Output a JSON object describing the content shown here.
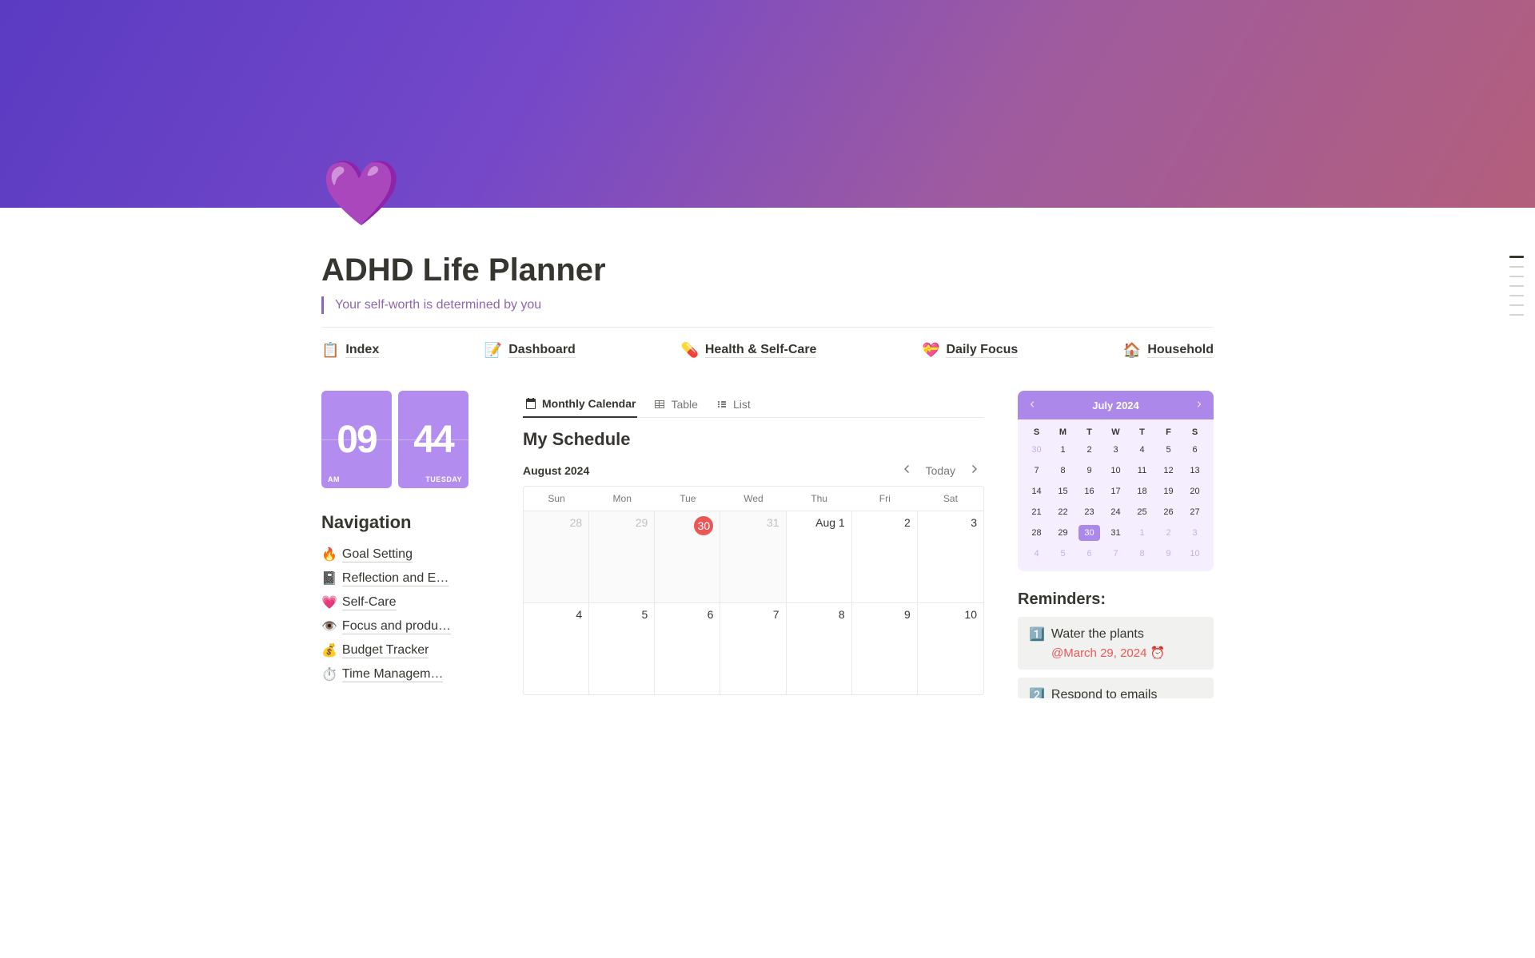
{
  "page": {
    "icon": "💜",
    "title": "ADHD Life Planner",
    "quote": "Your self-worth is determined by you"
  },
  "topNav": [
    {
      "emoji": "📋",
      "label": "Index"
    },
    {
      "emoji": "📝",
      "label": "Dashboard"
    },
    {
      "emoji": "💊",
      "label": "Health & Self-Care"
    },
    {
      "emoji": "💝",
      "label": "Daily Focus"
    },
    {
      "emoji": "🏠",
      "label": "Household"
    }
  ],
  "clock": {
    "hours": "09",
    "mins": "44",
    "ampm": "AM",
    "day": "TUESDAY"
  },
  "navigation": {
    "title": "Navigation",
    "items": [
      {
        "emoji": "🔥",
        "label": "Goal Setting"
      },
      {
        "emoji": "📓",
        "label": "Reflection and E…"
      },
      {
        "emoji": "💗",
        "label": "Self-Care"
      },
      {
        "emoji": "👁️",
        "label": "Focus and produ…"
      },
      {
        "emoji": "💰",
        "label": "Budget Tracker"
      },
      {
        "emoji": "⏱️",
        "label": "Time Managem…"
      }
    ]
  },
  "schedule": {
    "tabs": [
      {
        "label": "Monthly Calendar",
        "icon": "cal",
        "active": true
      },
      {
        "label": "Table",
        "icon": "table",
        "active": false
      },
      {
        "label": "List",
        "icon": "list",
        "active": false
      }
    ],
    "title": "My Schedule",
    "monthLabel": "August 2024",
    "todayLabel": "Today",
    "dows": [
      "Sun",
      "Mon",
      "Tue",
      "Wed",
      "Thu",
      "Fri",
      "Sat"
    ],
    "weeks": [
      [
        {
          "label": "28",
          "faded": true,
          "today": false
        },
        {
          "label": "29",
          "faded": true,
          "today": false
        },
        {
          "label": "30",
          "faded": true,
          "today": true
        },
        {
          "label": "31",
          "faded": true,
          "today": false
        },
        {
          "label": "Aug 1",
          "faded": false,
          "today": false,
          "monthFirst": true
        },
        {
          "label": "2",
          "faded": false,
          "today": false
        },
        {
          "label": "3",
          "faded": false,
          "today": false
        }
      ],
      [
        {
          "label": "4",
          "faded": false,
          "today": false
        },
        {
          "label": "5",
          "faded": false,
          "today": false
        },
        {
          "label": "6",
          "faded": false,
          "today": false
        },
        {
          "label": "7",
          "faded": false,
          "today": false
        },
        {
          "label": "8",
          "faded": false,
          "today": false
        },
        {
          "label": "9",
          "faded": false,
          "today": false
        },
        {
          "label": "10",
          "faded": false,
          "today": false
        }
      ]
    ]
  },
  "mini": {
    "title": "July 2024",
    "dows": [
      "S",
      "M",
      "T",
      "W",
      "T",
      "F",
      "S"
    ],
    "days": [
      {
        "n": "30",
        "faded": true
      },
      {
        "n": "1"
      },
      {
        "n": "2"
      },
      {
        "n": "3"
      },
      {
        "n": "4"
      },
      {
        "n": "5"
      },
      {
        "n": "6"
      },
      {
        "n": "7"
      },
      {
        "n": "8"
      },
      {
        "n": "9"
      },
      {
        "n": "10"
      },
      {
        "n": "11"
      },
      {
        "n": "12"
      },
      {
        "n": "13"
      },
      {
        "n": "14"
      },
      {
        "n": "15"
      },
      {
        "n": "16"
      },
      {
        "n": "17"
      },
      {
        "n": "18"
      },
      {
        "n": "19"
      },
      {
        "n": "20"
      },
      {
        "n": "21"
      },
      {
        "n": "22"
      },
      {
        "n": "23"
      },
      {
        "n": "24"
      },
      {
        "n": "25"
      },
      {
        "n": "26"
      },
      {
        "n": "27"
      },
      {
        "n": "28"
      },
      {
        "n": "29"
      },
      {
        "n": "30",
        "sel": true
      },
      {
        "n": "31"
      },
      {
        "n": "1",
        "faded": true
      },
      {
        "n": "2",
        "faded": true
      },
      {
        "n": "3",
        "faded": true
      },
      {
        "n": "4",
        "faded": true
      },
      {
        "n": "5",
        "faded": true
      },
      {
        "n": "6",
        "faded": true
      },
      {
        "n": "7",
        "faded": true
      },
      {
        "n": "8",
        "faded": true
      },
      {
        "n": "9",
        "faded": true
      },
      {
        "n": "10",
        "faded": true
      }
    ]
  },
  "reminders": {
    "title": "Reminders:",
    "items": [
      {
        "emoji": "1️⃣",
        "text": "Water the plants",
        "date": "@March 29, 2024 ⏰"
      },
      {
        "emoji": "2️⃣",
        "text": "Respond to emails",
        "date": ""
      }
    ]
  }
}
